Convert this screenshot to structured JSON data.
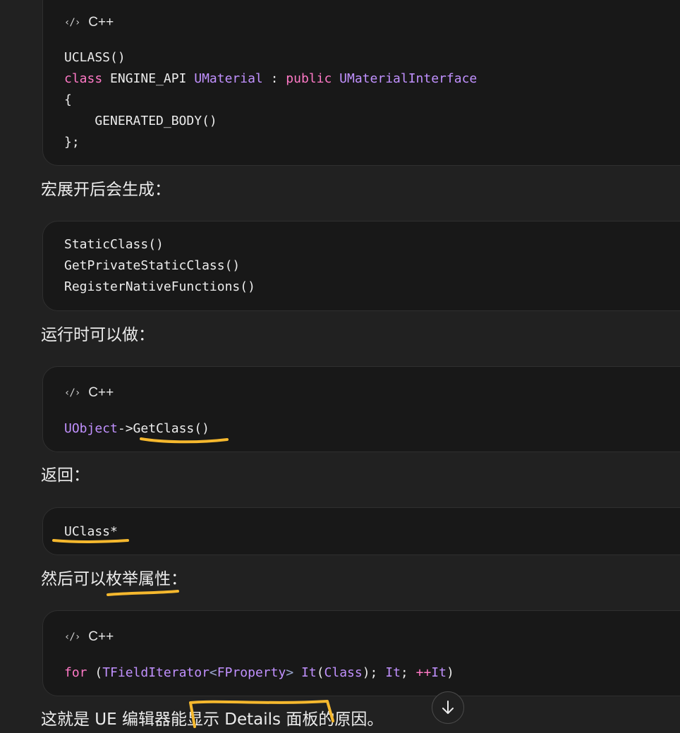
{
  "blocks": {
    "b1": {
      "lang": "C++",
      "lines": [
        [
          "UCLASS()"
        ],
        [
          "class",
          " ENGINE_API ",
          "UMaterial",
          " : ",
          "public",
          " ",
          "UMaterialInterface"
        ],
        [
          "{"
        ],
        [
          "    GENERATED_BODY()"
        ],
        [
          "};"
        ]
      ]
    },
    "b2": {
      "lines": [
        [
          "StaticClass()"
        ],
        [
          "GetPrivateStaticClass()"
        ],
        [
          "RegisterNativeFunctions()"
        ]
      ]
    },
    "b3": {
      "lang": "C++",
      "lines": [
        [
          "UObject",
          "->",
          "GetClass()"
        ]
      ]
    },
    "b4": {
      "lines": [
        [
          "UClass*"
        ]
      ]
    },
    "b5": {
      "lang": "C++",
      "lines": [
        [
          "for",
          " (",
          "TFieldIterator",
          "<",
          "FProperty",
          ">",
          " ",
          "It",
          "(",
          "Class",
          "); ",
          "It",
          "; ",
          "++",
          "It",
          ")"
        ]
      ]
    }
  },
  "paragraphs": {
    "p1": "宏展开后会生成：",
    "p2": "运行时可以做：",
    "p3": "返回：",
    "p4": "然后可以枚举属性：",
    "p5": "这就是 UE 编辑器能显示 Details 面板的原因。"
  },
  "icons": {
    "code": "code-icon",
    "scroll": "arrow-down-icon"
  },
  "colors": {
    "background": "#212121",
    "code_background": "#181818",
    "keyword": "#ff79c6",
    "type": "#c191ff",
    "highlight_marker": "#f5b82e"
  }
}
